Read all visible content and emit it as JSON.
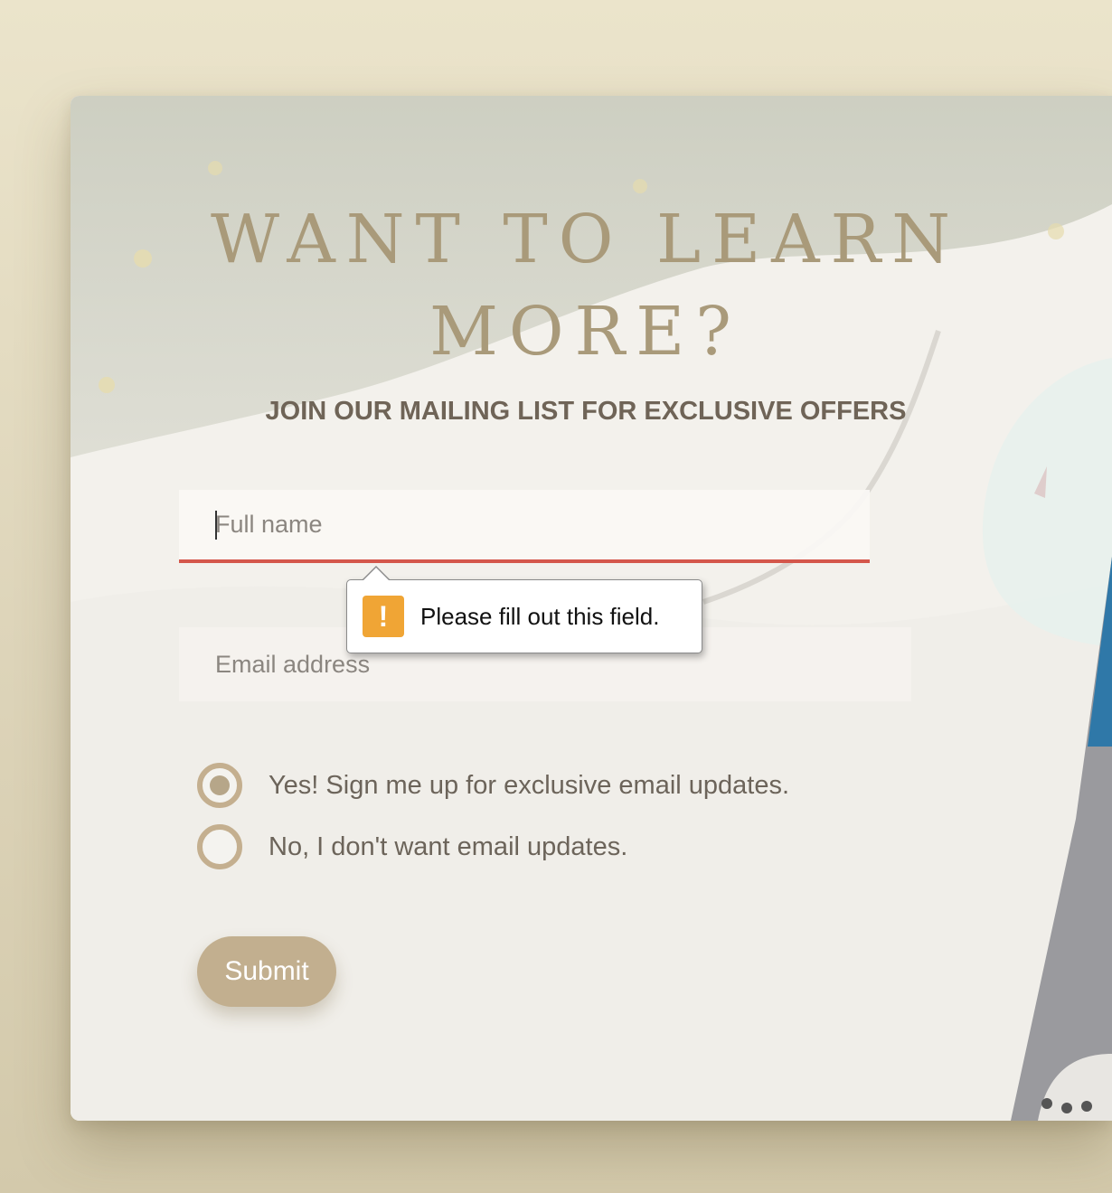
{
  "heading": {
    "title": "WANT TO LEARN MORE?",
    "subtitle": "JOIN OUR MAILING LIST FOR EXCLUSIVE OFFERS"
  },
  "form": {
    "name_placeholder": "Full name",
    "email_placeholder": "Email address",
    "validation_message": "Please fill out this field.",
    "validation_icon": "warning-icon",
    "options": [
      {
        "label": "Yes! Sign me up for exclusive email updates.",
        "selected": true
      },
      {
        "label": "No, I don't want email updates.",
        "selected": false
      }
    ],
    "submit_label": "Submit"
  },
  "colors": {
    "accent": "#c2af8f",
    "error": "#d4574b",
    "warning": "#f0a535",
    "title": "#a99a7a",
    "subtitle": "#6f6457"
  }
}
